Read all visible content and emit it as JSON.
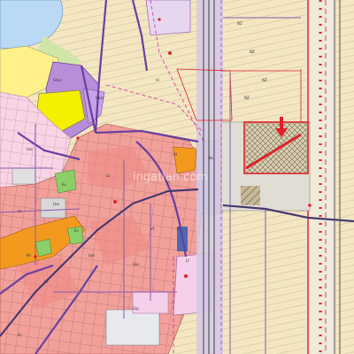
{
  "map": {
    "type": "zoning plan",
    "watermark": "ingatlan.com",
    "zone_labels": [
      "NZ",
      "NZ",
      "NZ",
      "NZ",
      "Vi",
      "Vi",
      "Gksz",
      "Gksz",
      "Lke",
      "Lke",
      "Lke",
      "Lke",
      "Lk",
      "Lk",
      "Vt",
      "Vt",
      "Ev",
      "Ev",
      "Gip",
      "Kt",
      "Ke",
      "Ke",
      "Lf",
      "Lf",
      "Vi"
    ],
    "colors": {
      "residential": "#f2a09a",
      "residential_dark": "#ee8b86",
      "agricultural": "#f3e6c0",
      "water": "#b9d9f4",
      "industrial": "#b98ed8",
      "commercial_yellow": "#fff08a",
      "bright_yellow": "#f5f000",
      "orange_zone": "#f39a1e",
      "green_zone": "#8ccf6a",
      "rail_corridor": "#d4c8e8",
      "gray_zone": "#d8d8d8",
      "boundary_red": "#e0202a",
      "road_purple": "#6a3fa0",
      "parcel_line": "#8a8a7a"
    },
    "marker": {
      "type": "arrow",
      "color": "#e0202a",
      "direction": "down"
    }
  }
}
